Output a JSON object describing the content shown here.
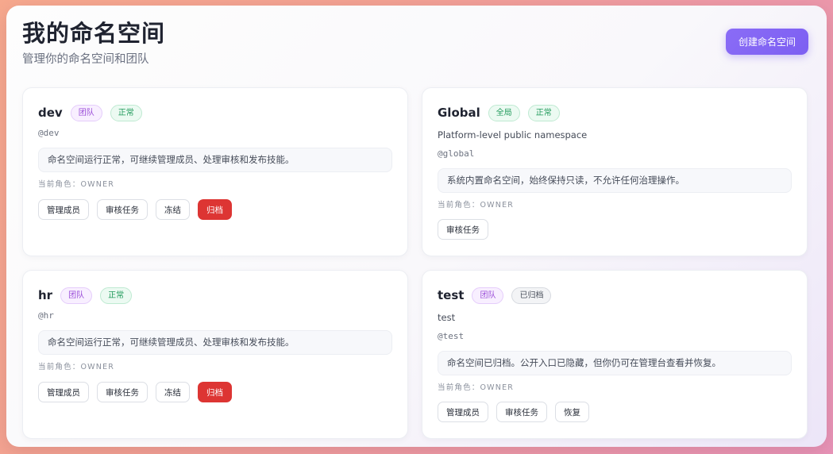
{
  "header": {
    "title": "我的命名空间",
    "subtitle": "管理你的命名空间和团队",
    "create_button": "创建命名空间"
  },
  "cards": [
    {
      "name": "dev",
      "badges": [
        "团队",
        "正常"
      ],
      "description": "",
      "handle": "@dev",
      "status_text": "命名空间运行正常，可继续管理成员、处理审核和发布技能。",
      "role": "当前角色：OWNER",
      "actions": [
        "管理成员",
        "审核任务",
        "冻结",
        "归档"
      ]
    },
    {
      "name": "Global",
      "badges": [
        "全局",
        "正常"
      ],
      "description": "Platform-level public namespace",
      "handle": "@global",
      "status_text": "系统内置命名空间，始终保持只读，不允许任何治理操作。",
      "role": "当前角色：OWNER",
      "actions": [
        "审核任务"
      ]
    },
    {
      "name": "hr",
      "badges": [
        "团队",
        "正常"
      ],
      "description": "",
      "handle": "@hr",
      "status_text": "命名空间运行正常，可继续管理成员、处理审核和发布技能。",
      "role": "当前角色：OWNER",
      "actions": [
        "管理成员",
        "审核任务",
        "冻结",
        "归档"
      ]
    },
    {
      "name": "test",
      "badges": [
        "团队",
        "已归档"
      ],
      "description": "test",
      "handle": "@test",
      "status_text": "命名空间已归档。公开入口已隐藏，但你仍可在管理台查看并恢复。",
      "role": "当前角色：OWNER",
      "actions": [
        "管理成员",
        "审核任务",
        "恢复"
      ]
    }
  ],
  "colors": {
    "accent": "#7d5ff2",
    "danger": "#dd3533",
    "team_badge": "#9b4ed8",
    "normal_badge": "#1f9a5a",
    "archived_badge": "#4a505c"
  }
}
